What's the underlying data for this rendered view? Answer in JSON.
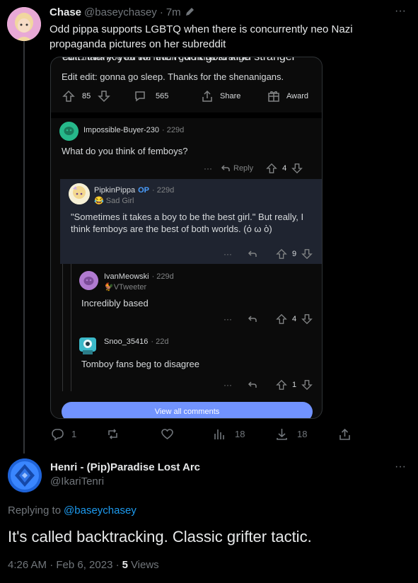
{
  "tweet": {
    "author_name": "Chase",
    "author_handle": "@baseychasey",
    "separator": "·",
    "time": "7m",
    "text": "Odd pippa supports LGBTQ when there is concurrently neo Nazi propaganda pictures on her subreddit",
    "actions": {
      "replies": "1",
      "retweets": "",
      "likes": "",
      "views": "18",
      "downloads": "18"
    }
  },
  "reddit": {
    "cut_line": "edit: thank you for the reddit gold kind stranger",
    "edit_line": "Edit edit: gonna go sleep. Thanks for the shenanigans.",
    "post_votes": "85",
    "post_comments": "565",
    "share_label": "Share",
    "award_label": "Award",
    "comments": [
      {
        "user": "Impossible-Buyer-230",
        "time": "· 229d",
        "text": "What do you think of femboys?",
        "reply_label": "Reply",
        "votes": "4",
        "more": "···"
      },
      {
        "user": "PipkinPippa",
        "op_badge": "OP",
        "time": "· 229d",
        "flair": "😂 Sad Girl",
        "text": "\"Sometimes it takes a boy to be the best girl.\" But really, I think femboys are the best of both worlds. (ό ω ὸ)",
        "votes": "9",
        "more": "···"
      },
      {
        "user": "IvanMeowski",
        "time": "· 229d",
        "flair": "🐓VTweeter",
        "text": "Incredibly based",
        "votes": "4",
        "more": "···"
      },
      {
        "user": "Snoo_35416",
        "time": "· 22d",
        "text": "Tomboy fans beg to disagree",
        "votes": "1",
        "more": "···"
      }
    ],
    "view_all_label": "View all comments"
  },
  "reply": {
    "author_name": "Henri - (Pip)Paradise Lost Arc",
    "author_handle": "@IkariTenri",
    "replying_prefix": "Replying to",
    "replying_handle": "@baseychasey",
    "text": "It's called backtracking. Classic grifter tactic.",
    "timestamp": "4:26 AM · Feb 6, 2023 ·",
    "views_count": "5",
    "views_label": "Views"
  },
  "colors": {
    "accent": "#1d9bf0",
    "op_blue": "#4a9eff",
    "button_blue": "#7193ff"
  }
}
